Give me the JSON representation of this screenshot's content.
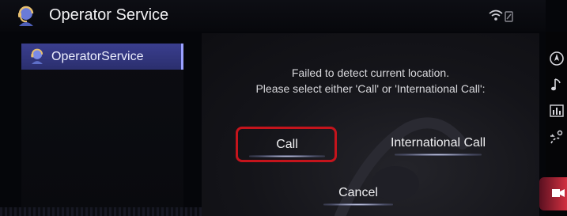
{
  "header": {
    "title": "Operator Service",
    "icon": "operator-headset-icon",
    "status_icons": [
      "wifi-icon",
      "signal-icon"
    ]
  },
  "sidebar": {
    "items": [
      {
        "label": "OperatorService",
        "icon": "operator-headset-icon",
        "selected": true
      }
    ]
  },
  "dialog": {
    "message_line1": "Failed to detect current location.",
    "message_line2": "Please select either 'Call' or 'International Call':",
    "buttons": {
      "call": "Call",
      "international_call": "International Call",
      "cancel": "Cancel"
    },
    "focused_button": "call"
  },
  "right_rail": {
    "icons": [
      "navigation-icon",
      "music-note-icon",
      "equalizer-icon",
      "route-icon",
      "camera-icon"
    ],
    "active_icon": "camera-icon"
  },
  "colors": {
    "accent": "#3a3e8e",
    "focus": "#c4141c",
    "active_rail": "#d23040"
  }
}
